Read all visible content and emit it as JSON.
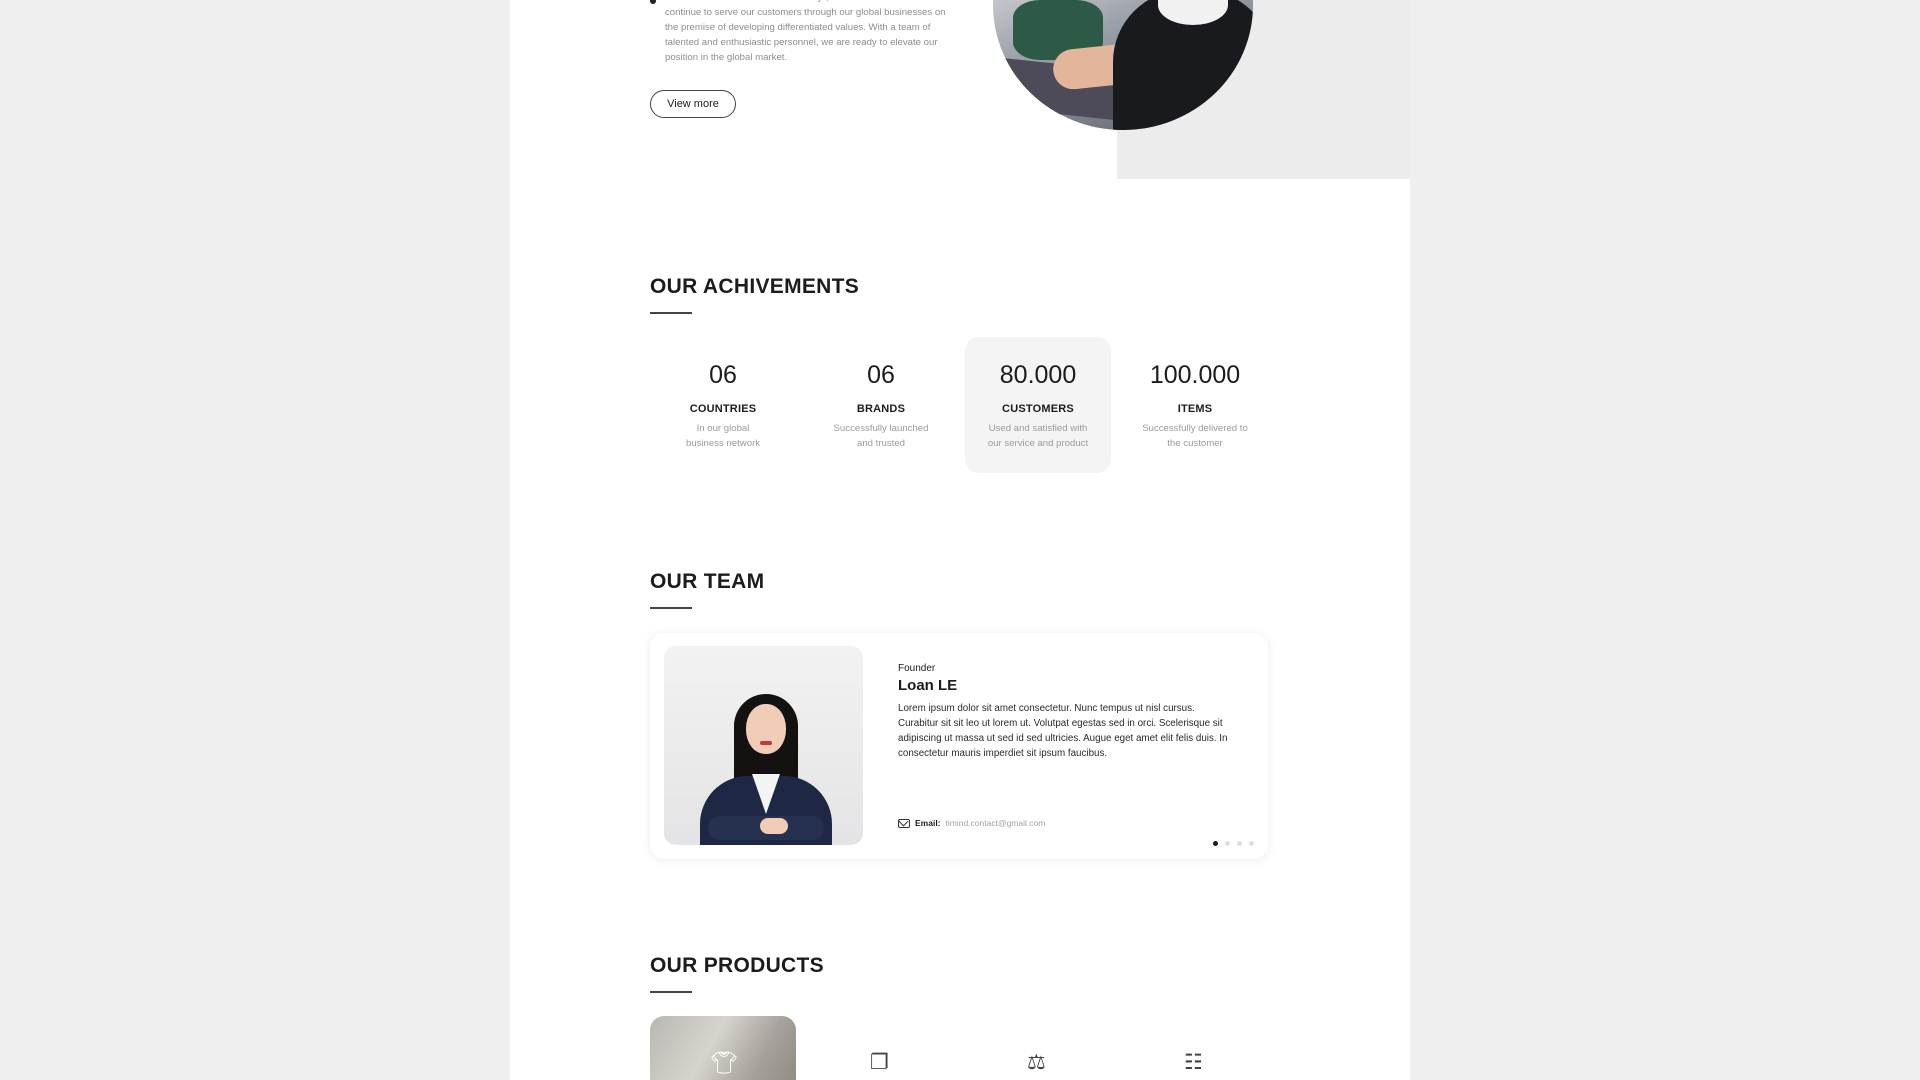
{
  "about": {
    "text": "With the motto \"customer is centricity\", Timind has been and will continue to serve our customers through our global businesses on the premise of developing differentiated values.  With a team of talented and enthusiastic personnel, we are ready to elevate our position in the global market.",
    "view_more_label": "View more"
  },
  "achievements": {
    "title": "OUR ACHIVEMENTS",
    "items": [
      {
        "value": "06",
        "label": "COUNTRIES",
        "desc": "In our global business network"
      },
      {
        "value": "06",
        "label": "BRANDS",
        "desc": "Successfully launched and trusted"
      },
      {
        "value": "80.000",
        "label": "CUSTOMERS",
        "desc": "Used and satisfied with our service and product"
      },
      {
        "value": "100.000",
        "label": "ITEMS",
        "desc": "Successfully delivered to the customer"
      }
    ]
  },
  "team": {
    "title": "OUR TEAM",
    "member": {
      "role": "Founder",
      "name": "Loan LE",
      "bio": "Lorem ipsum dolor sit amet consectetur. Nunc tempus ut nisl cursus. Curabitur sit sit leo ut lorem ut. Volutpat egestas sed in orci. Scelerisque sit adipiscing ut massa ut sed id sed ultricies. Augue eget amet elit felis duis. In consectetur mauris imperdiet sit ipsum faucibus.",
      "email_label": "Email:",
      "email": "timind.contact@gmail.com"
    },
    "carousel": {
      "total": 4,
      "active": 1
    }
  },
  "products": {
    "title": "OUR PRODUCTS",
    "icons": [
      "shirt-icon",
      "layers-icon",
      "handshake-icon",
      "calendar-dollar-icon"
    ]
  }
}
